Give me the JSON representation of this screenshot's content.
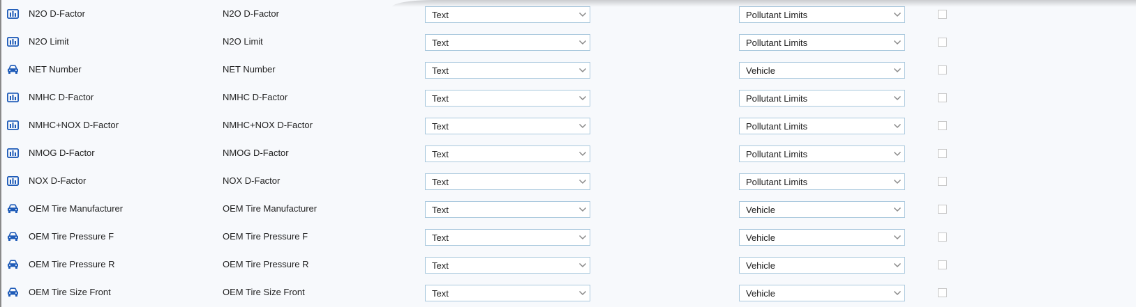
{
  "rows": [
    {
      "icon": "bar-chart-icon",
      "name": "N2O D-Factor",
      "label": "N2O D-Factor",
      "type": "Text",
      "category": "Pollutant Limits",
      "checked": false
    },
    {
      "icon": "bar-chart-icon",
      "name": "N2O Limit",
      "label": "N2O Limit",
      "type": "Text",
      "category": "Pollutant Limits",
      "checked": false
    },
    {
      "icon": "car-icon",
      "name": "NET Number",
      "label": "NET Number",
      "type": "Text",
      "category": "Vehicle",
      "checked": false
    },
    {
      "icon": "bar-chart-icon",
      "name": "NMHC D-Factor",
      "label": "NMHC D-Factor",
      "type": "Text",
      "category": "Pollutant Limits",
      "checked": false
    },
    {
      "icon": "bar-chart-icon",
      "name": "NMHC+NOX D-Factor",
      "label": "NMHC+NOX D-Factor",
      "type": "Text",
      "category": "Pollutant Limits",
      "checked": false
    },
    {
      "icon": "bar-chart-icon",
      "name": "NMOG D-Factor",
      "label": "NMOG D-Factor",
      "type": "Text",
      "category": "Pollutant Limits",
      "checked": false
    },
    {
      "icon": "bar-chart-icon",
      "name": "NOX D-Factor",
      "label": "NOX D-Factor",
      "type": "Text",
      "category": "Pollutant Limits",
      "checked": false
    },
    {
      "icon": "car-icon",
      "name": "OEM Tire Manufacturer",
      "label": "OEM Tire Manufacturer",
      "type": "Text",
      "category": "Vehicle",
      "checked": false
    },
    {
      "icon": "car-icon",
      "name": "OEM Tire Pressure F",
      "label": "OEM Tire Pressure F",
      "type": "Text",
      "category": "Vehicle",
      "checked": false
    },
    {
      "icon": "car-icon",
      "name": "OEM Tire Pressure R",
      "label": "OEM Tire Pressure R",
      "type": "Text",
      "category": "Vehicle",
      "checked": false
    },
    {
      "icon": "car-icon",
      "name": "OEM Tire Size Front",
      "label": "OEM Tire Size Front",
      "type": "Text",
      "category": "Vehicle",
      "checked": false
    }
  ],
  "colors": {
    "icon": "#1e5bb8",
    "select_border": "#a9c8dd",
    "panel_bg": "#f7f9fc",
    "checkbox_border": "#c8c8c8",
    "chevron": "#8a8a8a"
  }
}
